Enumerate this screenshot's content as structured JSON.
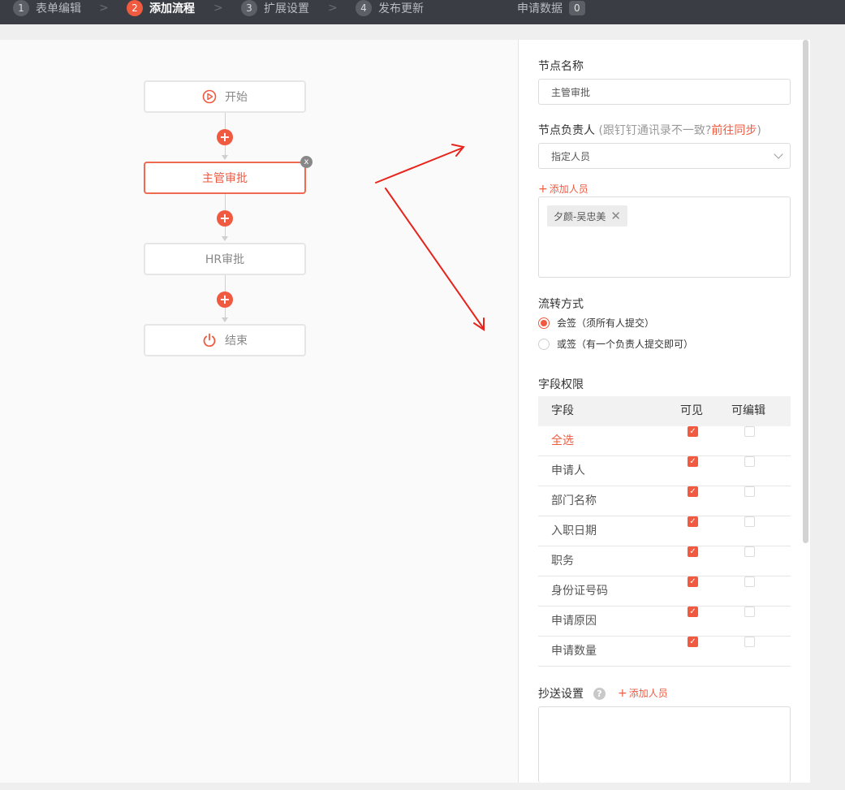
{
  "steps": [
    {
      "num": "1",
      "label": "表单编辑"
    },
    {
      "num": "2",
      "label": "添加流程"
    },
    {
      "num": "3",
      "label": "扩展设置"
    },
    {
      "num": "4",
      "label": "发布更新"
    }
  ],
  "apply_data": {
    "label": "申请数据",
    "count": "0"
  },
  "flow": {
    "start": "开始",
    "manager": "主管审批",
    "hr": "HR审批",
    "end": "结束",
    "close": "x",
    "plus": "+"
  },
  "panel": {
    "node_name_label": "节点名称",
    "node_name_value": "主管审批",
    "owner_label": "节点负责人",
    "owner_hint": "(跟钉钉通讯录不一致?",
    "owner_sync_link": "前往同步",
    "owner_hint_end": ")",
    "owner_select": "指定人员",
    "add_person": "添加人员",
    "person_tag": "夕颜-吴忠美",
    "flow_mode_label": "流转方式",
    "mode_all": "会签（须所有人提交）",
    "mode_any": "或签（有一个负责人提交即可）",
    "perm_label": "字段权限",
    "col_field": "字段",
    "col_visible": "可见",
    "col_editable": "可编辑",
    "rows": [
      {
        "field": "全选"
      },
      {
        "field": "申请人"
      },
      {
        "field": "部门名称"
      },
      {
        "field": "入职日期"
      },
      {
        "field": "职务"
      },
      {
        "field": "身份证号码"
      },
      {
        "field": "申请原因"
      },
      {
        "field": "申请数量"
      }
    ],
    "cc_label": "抄送设置",
    "cc_help": "?",
    "cc_add": "添加人员"
  },
  "colors": {
    "accent": "#f05a40",
    "topbar": "#3a3d44"
  }
}
